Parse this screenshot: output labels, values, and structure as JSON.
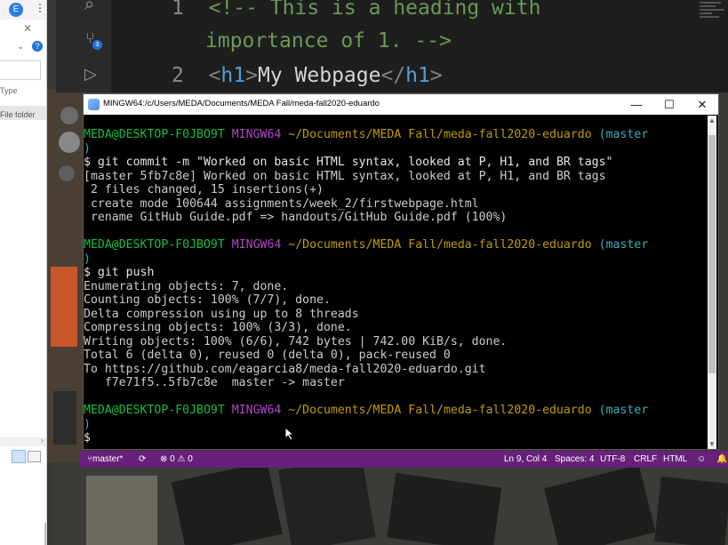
{
  "explorer": {
    "avatar_letter": "E",
    "more_glyph": "⋮",
    "close_glyph": "✕",
    "chevron_glyph": "⌄",
    "help_glyph": "?",
    "column_type": "Type",
    "row_type": "File folder",
    "scroll_arrow": "›"
  },
  "editor": {
    "lines": [
      {
        "number": "1",
        "open": "<!--",
        "comment": " This is a heading with"
      },
      {
        "number": "",
        "comment_cont": "importance of 1. -->"
      },
      {
        "number": "2",
        "tag_open": "h1",
        "text": "My Webpage",
        "tag_close": "h1"
      }
    ],
    "scm_badge": "3"
  },
  "terminal": {
    "title": "MINGW64:/c/Users/MEDA/Documents/MEDA Fall/meda-fall2020-eduardo",
    "minimize": "—",
    "maximize": "☐",
    "close": "✕",
    "prompt": {
      "user": "MEDA@DESKTOP-F0JBO9T",
      "shell": "MINGW64",
      "path": "~/Documents/MEDA Fall/meda-fall2020-eduardo",
      "branch": "(master",
      "branch_close": ")"
    },
    "commit_cmd": "$ git commit -m \"Worked on basic HTML syntax, looked at P, H1, and BR tags\"",
    "commit_output": [
      "[master 5fb7c8e] Worked on basic HTML syntax, looked at P, H1, and BR tags",
      " 2 files changed, 15 insertions(+)",
      " create mode 100644 assignments/week_2/firstwebpage.html",
      " rename GitHub Guide.pdf => handouts/GitHub Guide.pdf (100%)"
    ],
    "push_cmd": "$ git push",
    "push_output": [
      "Enumerating objects: 7, done.",
      "Counting objects: 100% (7/7), done.",
      "Delta compression using up to 8 threads",
      "Compressing objects: 100% (3/3), done.",
      "Writing objects: 100% (6/6), 742 bytes | 742.00 KiB/s, done.",
      "Total 6 (delta 0), reused 0 (delta 0), pack-reused 0",
      "To https://github.com/eagarcia8/meda-fall2020-eduardo.git",
      "   f7e71f5..5fb7c8e  master -> master"
    ],
    "final_prompt": "$"
  },
  "statusbar": {
    "branch": "master*",
    "sync_glyph": "⟳",
    "problems": "⊗ 0 ⚠ 0",
    "position": "Ln 9, Col 4",
    "spaces": "Spaces: 4",
    "encoding": "UTF-8",
    "eol": "CRLF",
    "language": "HTML",
    "feedback_glyph": "☺",
    "bell_glyph": "🔔"
  },
  "colors": {
    "prompt_user": "#13bf3f",
    "prompt_shell": "#b148c6",
    "prompt_path": "#c19c00",
    "prompt_branch": "#3ab0c0",
    "statusbar": "#68217a"
  }
}
